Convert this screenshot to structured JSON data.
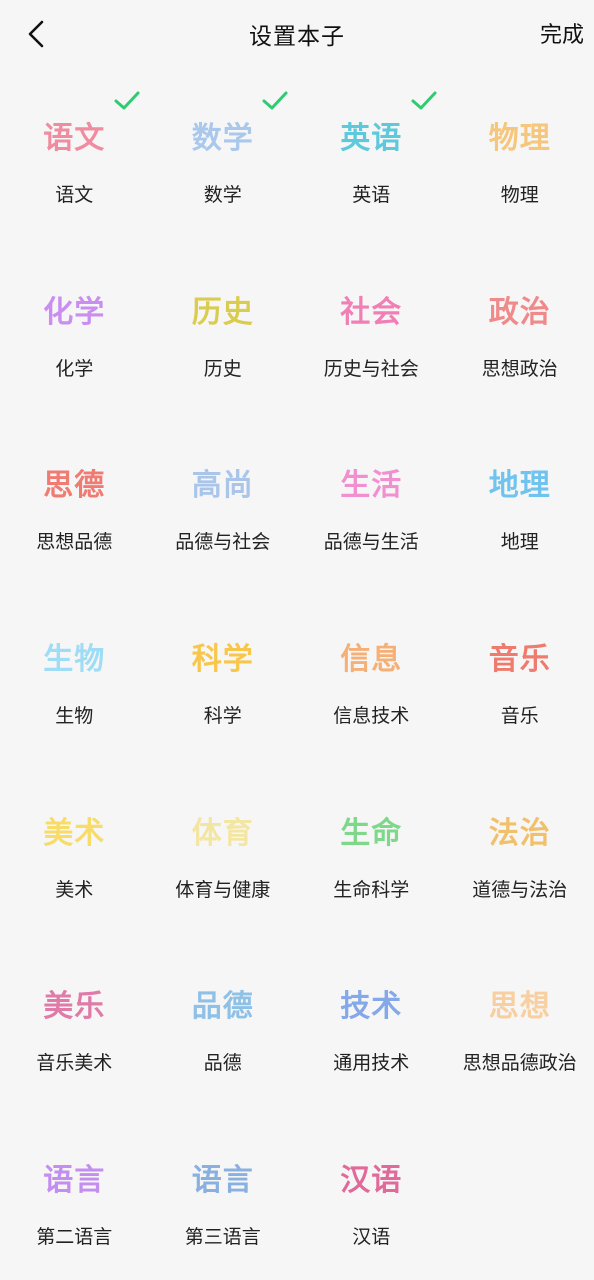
{
  "header": {
    "title": "设置本子",
    "done_label": "完成"
  },
  "accent": "#2ecc71",
  "subjects": [
    {
      "cover": "语文",
      "label": "语文",
      "color": "#f08ca0",
      "selected": true
    },
    {
      "cover": "数学",
      "label": "数学",
      "color": "#a9c8ec",
      "selected": true
    },
    {
      "cover": "英语",
      "label": "英语",
      "color": "#5fc9dc",
      "selected": true
    },
    {
      "cover": "物理",
      "label": "物理",
      "color": "#f5c67c",
      "selected": false
    },
    {
      "cover": "化学",
      "label": "化学",
      "color": "#c98ef0",
      "selected": false
    },
    {
      "cover": "历史",
      "label": "历史",
      "color": "#d9cc4e",
      "selected": false
    },
    {
      "cover": "社会",
      "label": "历史与社会",
      "color": "#f07fb5",
      "selected": false
    },
    {
      "cover": "政治",
      "label": "思想政治",
      "color": "#f08a8a",
      "selected": false
    },
    {
      "cover": "思德",
      "label": "思想品德",
      "color": "#ef7b72",
      "selected": false
    },
    {
      "cover": "高尚",
      "label": "品德与社会",
      "color": "#a9c5ea",
      "selected": false
    },
    {
      "cover": "生活",
      "label": "品德与生活",
      "color": "#f28fd0",
      "selected": false
    },
    {
      "cover": "地理",
      "label": "地理",
      "color": "#6fc3ef",
      "selected": false
    },
    {
      "cover": "生物",
      "label": "生物",
      "color": "#9fdcf5",
      "selected": false
    },
    {
      "cover": "科学",
      "label": "科学",
      "color": "#f7c64a",
      "selected": false
    },
    {
      "cover": "信息",
      "label": "信息技术",
      "color": "#f5b078",
      "selected": false
    },
    {
      "cover": "音乐",
      "label": "音乐",
      "color": "#ef7b6e",
      "selected": false
    },
    {
      "cover": "美术",
      "label": "美术",
      "color": "#f7dc6a",
      "selected": false
    },
    {
      "cover": "体育",
      "label": "体育与健康",
      "color": "#f2e6a2",
      "selected": false
    },
    {
      "cover": "生命",
      "label": "生命科学",
      "color": "#7fd88a",
      "selected": false
    },
    {
      "cover": "法治",
      "label": "道德与法治",
      "color": "#f0c06c",
      "selected": false
    },
    {
      "cover": "美乐",
      "label": "音乐美术",
      "color": "#e07aa8",
      "selected": false
    },
    {
      "cover": "品德",
      "label": "品德",
      "color": "#8fc0e6",
      "selected": false
    },
    {
      "cover": "技术",
      "label": "通用技术",
      "color": "#84a8e8",
      "selected": false
    },
    {
      "cover": "思想",
      "label": "思想品德政治",
      "color": "#f7cfa0",
      "selected": false
    },
    {
      "cover": "语言",
      "label": "第二语言",
      "color": "#c28ef0",
      "selected": false
    },
    {
      "cover": "语言",
      "label": "第三语言",
      "color": "#8ab0e0",
      "selected": false
    },
    {
      "cover": "汉语",
      "label": "汉语",
      "color": "#e06a9a",
      "selected": false
    }
  ]
}
